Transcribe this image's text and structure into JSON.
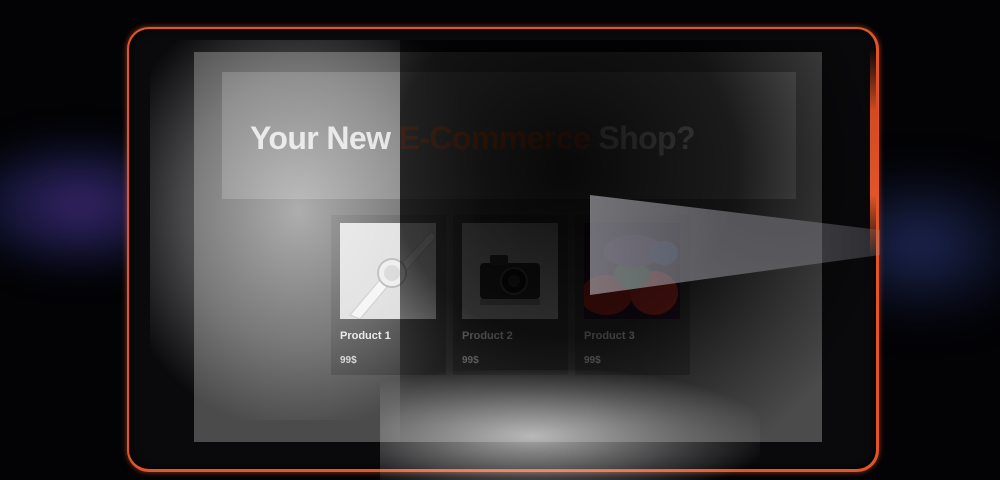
{
  "hero": {
    "title_before": "Your New ",
    "title_accent": "E-Commerce",
    "title_after": " Shop?"
  },
  "products": [
    {
      "name": "Product 1",
      "price": "99$",
      "image": "smartwatch-image"
    },
    {
      "name": "Product 2",
      "price": "99$",
      "image": "camera-image"
    },
    {
      "name": "Product 3",
      "price": "99$",
      "image": "colorful-abstract-image"
    }
  ],
  "colors": {
    "accent": "#e8692d",
    "device_border": "#e2552a",
    "screen_bg": "#4b4b4c",
    "card_bg": "#3a3a3b"
  }
}
